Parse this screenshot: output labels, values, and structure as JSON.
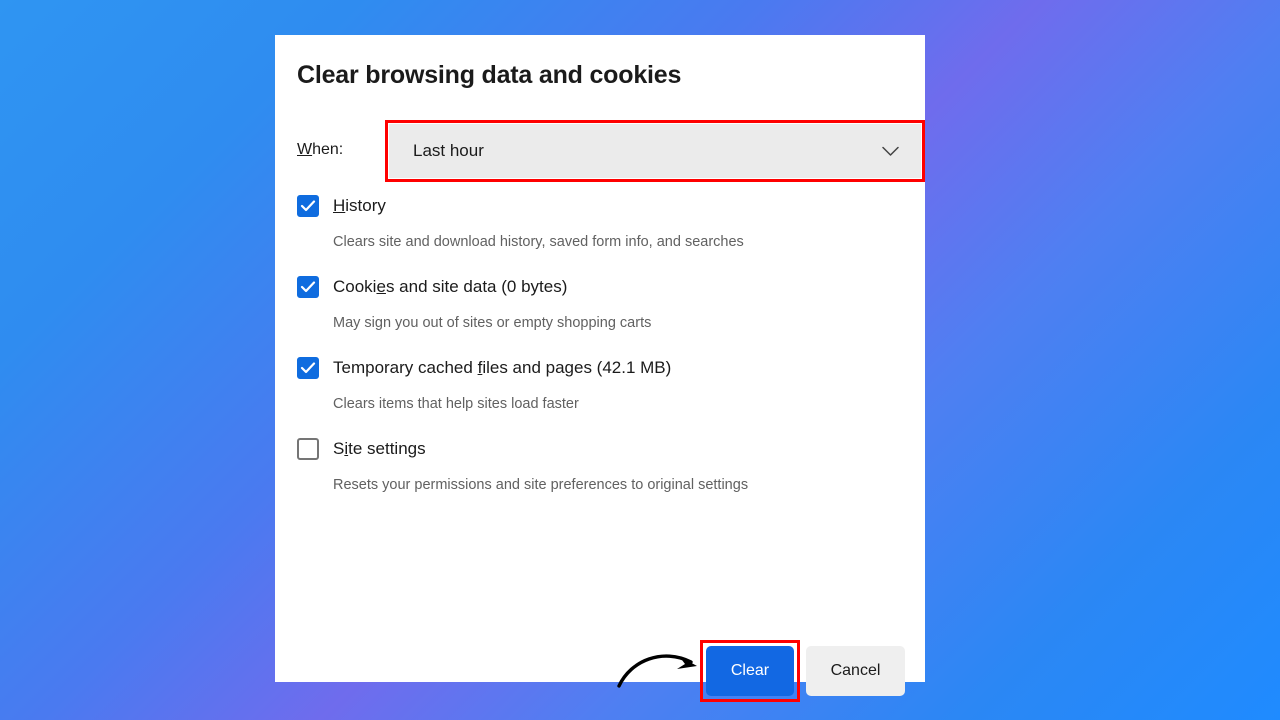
{
  "background": {
    "gradient_from": "#2f95f2",
    "gradient_mid": "#6f6ced",
    "gradient_to": "#1f8bff"
  },
  "dialog": {
    "title": "Clear browsing data and cookies",
    "surface_color": "#ffffff"
  },
  "when": {
    "label_prefix": "W",
    "label_rest": "hen:",
    "selected_value": "Last hour",
    "chevron_icon": "chevron-down-icon",
    "field_background": "#ebebeb",
    "highlight_color": "#ff0000"
  },
  "options": [
    {
      "checked": true,
      "label_prefix": "",
      "label_acc": "H",
      "label_rest": "istory",
      "description": "Clears site and download history, saved form info, and searches"
    },
    {
      "checked": true,
      "label_prefix": "Cooki",
      "label_acc": "e",
      "label_rest": "s and site data (0 bytes)",
      "description": "May sign you out of sites or empty shopping carts"
    },
    {
      "checked": true,
      "label_prefix": "Temporary cached ",
      "label_acc": "f",
      "label_rest": "iles and pages (42.1 MB)",
      "description": "Clears items that help sites load faster"
    },
    {
      "checked": false,
      "label_prefix": "S",
      "label_acc": "i",
      "label_rest": "te settings",
      "description": "Resets your permissions and site preferences to original settings"
    }
  ],
  "footer": {
    "clear_label": "Clear",
    "cancel_label": "Cancel",
    "clear_color": "#1268e3",
    "cancel_color": "#efefef",
    "highlight_color": "#ff0000",
    "arrow_icon": "curved-arrow-icon"
  }
}
